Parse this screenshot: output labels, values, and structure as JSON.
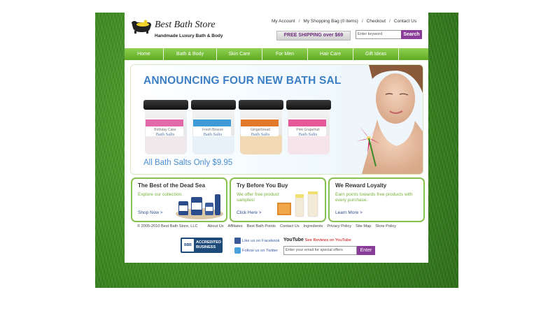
{
  "store": {
    "name": "Best Bath Store",
    "tagline": "Handmade Luxury Bath & Body"
  },
  "top_links": [
    "My Account",
    "My Shopping Bag (0 items)",
    "Checkout",
    "Contact Us"
  ],
  "shipping_banner": "FREE SHIPPING over $69",
  "search": {
    "placeholder": "Enter keyword",
    "button": "Search"
  },
  "nav": [
    "Home",
    "Bath & Body",
    "Skin Care",
    "For Men",
    "Hair Care",
    "Gift Ideas"
  ],
  "hero": {
    "title": "ANNOUNCING FOUR NEW BATH SALTS!",
    "price_line": "All Bath Salts Only $9.95",
    "products": [
      {
        "name": "Birthday Cake",
        "label": "Bath Salts",
        "stripe": "#e26aa8",
        "salt": "#f0e9ec"
      },
      {
        "name": "Fresh Breeze",
        "label": "Bath Salts",
        "stripe": "#3f9bd8",
        "salt": "#e8f1f7"
      },
      {
        "name": "Gingerbread",
        "label": "Bath Salts",
        "stripe": "#e07a2a",
        "salt": "#f1d9b6"
      },
      {
        "name": "Pink Grapefruit",
        "label": "Bath Salts",
        "stripe": "#e5599a",
        "salt": "#f5e4ea"
      }
    ]
  },
  "promos": [
    {
      "title": "The Best of the Dead Sea",
      "text": "Explore our collection.",
      "link": "Shop Now >"
    },
    {
      "title": "Try Before You Buy",
      "text": "We offer free product samples!",
      "link": "Click Here >"
    },
    {
      "title": "We Reward Loyalty",
      "text": "Earn points towards free products with every purchase.",
      "link": "Learn More >"
    }
  ],
  "footer": {
    "copyright": "© 2005-2010 Best Bath Store, LLC",
    "links": [
      "About Us",
      "Affiliates",
      "Best Bath Points",
      "Contact Us",
      "Ingredients",
      "Privacy Policy",
      "Site Map",
      "Store Policy"
    ],
    "bbb": {
      "seal": "BBB",
      "line1": "ACCREDITED",
      "line2": "BUSINESS"
    },
    "facebook": "Like us on Facebook",
    "twitter": "Follow us on Twitter",
    "youtube_logo": "YouTube",
    "youtube": "See Reviews on YouTube",
    "email_placeholder": "Enter your email for special offers",
    "enter_button": "Enter"
  },
  "colors": {
    "accent_purple": "#8a3d98",
    "nav_green": "#6cb52e",
    "hero_blue": "#3d7fc4",
    "promo_border": "#86c150"
  }
}
